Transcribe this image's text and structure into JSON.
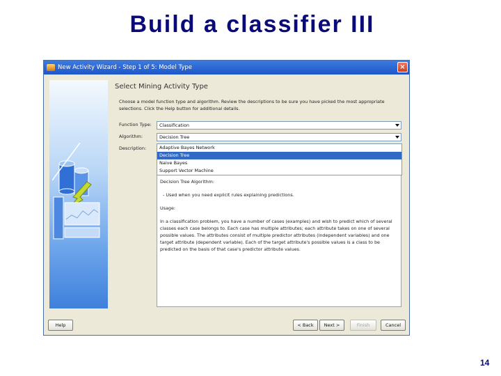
{
  "slide": {
    "title": "Build a classifier III",
    "page_number": "14"
  },
  "window": {
    "title": "New Activity Wizard - Step 1 of 5: Model Type",
    "close_symbol": "×"
  },
  "content": {
    "heading": "Select Mining Activity Type",
    "description": "Choose a model function type and algorithm. Review the descriptions to be sure you have picked the most appropriate selections. Click the Help button for additional details.",
    "function_type_label": "Function Type:",
    "function_type_value": "Classification",
    "algorithm_label": "Algorithm:",
    "algorithm_value": "Decision Tree",
    "description_label": "Description:",
    "algorithm_options": [
      "Adaptive Bayes Network",
      "Decision Tree",
      "Naive Bayes",
      "Support Vector Machine"
    ],
    "selected_option_index": 1,
    "description_text": {
      "algo_heading": "Decision Tree Algorithm:",
      "bullet": "- Used when you need explicit rules explaining predictions.",
      "usage_heading": "Usage:",
      "usage_body": "In a classification problem, you have a number of cases (examples) and wish to predict which of several classes each case belongs to. Each case has multiple attributes; each attribute takes on one of several possible values. The attributes consist of multiple predictor attributes (independent variables) and one target attribute (dependent variable). Each of the target attribute's possible values is a class to be predicted on the basis of that case's predictor attribute values."
    }
  },
  "buttons": {
    "help": "Help",
    "back": "< Back",
    "next": "Next >",
    "finish": "Finish",
    "cancel": "Cancel"
  },
  "colors": {
    "slide_title": "#0a0a78",
    "window_title_bar": "#1e56c8",
    "selection": "#316ac5",
    "dialog_bg": "#ece9d8"
  },
  "icons": [
    "window-app-icon",
    "close-icon",
    "wizard-illustration",
    "dropdown-arrow-icon"
  ]
}
